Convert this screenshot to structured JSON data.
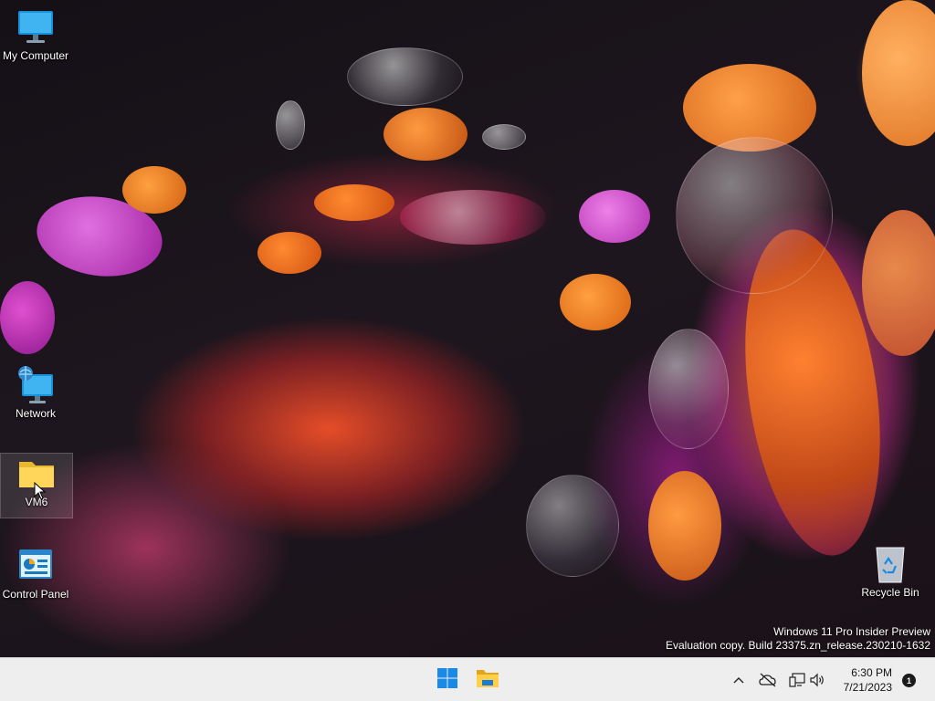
{
  "desktop": {
    "icons": [
      {
        "label": "My Computer",
        "icon": "monitor-icon"
      },
      {
        "label": "Network",
        "icon": "network-icon"
      },
      {
        "label": "VM6",
        "icon": "folder-icon"
      },
      {
        "label": "Control Panel",
        "icon": "control-panel-icon"
      },
      {
        "label": "Recycle Bin",
        "icon": "recycle-bin-icon"
      }
    ],
    "watermark": {
      "line1": "Windows 11 Pro Insider Preview",
      "line2": "Evaluation copy. Build 23375.zn_release.230210-1632"
    }
  },
  "taskbar": {
    "start_icon": "windows-start-icon",
    "pinned": [
      {
        "name": "File Explorer",
        "icon": "file-explorer-icon"
      }
    ],
    "tray": {
      "chevron_icon": "show-hidden-icons-chevron",
      "cloud_icon": "onedrive-offline-icon",
      "network_icon": "network-status-icon",
      "volume_icon": "speaker-icon"
    },
    "clock": {
      "time": "6:30 PM",
      "date": "7/21/2023"
    },
    "notification_count": "1"
  },
  "colors": {
    "taskbar_bg": "#eeeeee",
    "accent": "#0a74da"
  }
}
